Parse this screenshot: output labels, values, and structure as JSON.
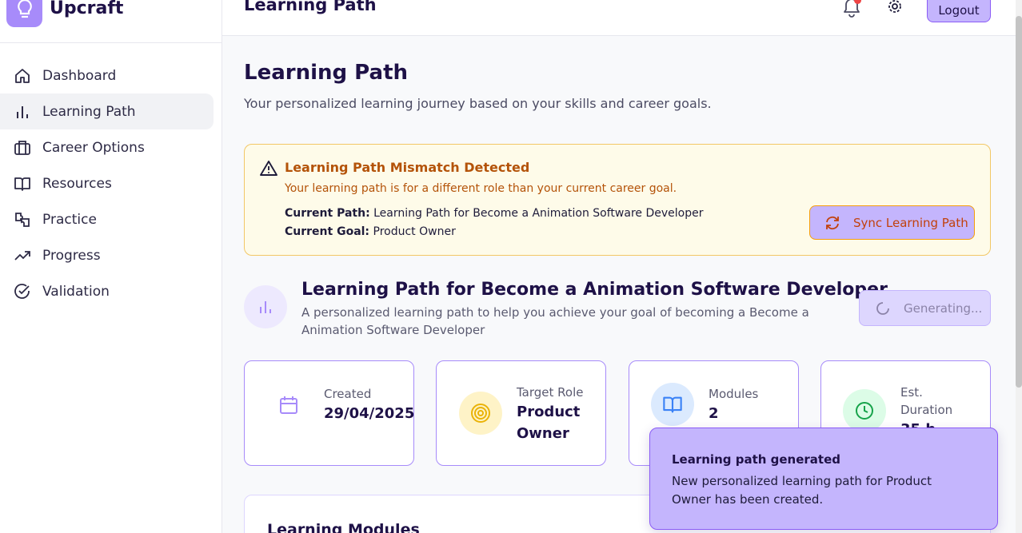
{
  "brand": {
    "name": "Upcraft",
    "accent": "#a78bfa"
  },
  "sidebar": {
    "items": [
      {
        "label": "Dashboard",
        "icon": "home-icon",
        "active": false
      },
      {
        "label": "Learning Path",
        "icon": "bar-chart-icon",
        "active": true
      },
      {
        "label": "Career Options",
        "icon": "briefcase-icon",
        "active": false
      },
      {
        "label": "Resources",
        "icon": "book-open-icon",
        "active": false
      },
      {
        "label": "Practice",
        "icon": "puzzle-icon",
        "active": false
      },
      {
        "label": "Progress",
        "icon": "trending-up-icon",
        "active": false
      },
      {
        "label": "Validation",
        "icon": "check-circle-icon",
        "active": false
      }
    ]
  },
  "header": {
    "title": "Learning Path",
    "logout_label": "Logout",
    "notification_icon": "bell-icon",
    "settings_icon": "gear-icon"
  },
  "page": {
    "title": "Learning Path",
    "subtitle": "Your personalized learning journey based on your skills and career goals."
  },
  "alert": {
    "title": "Learning Path Mismatch Detected",
    "description": "Your learning path is for a different role than your current career goal.",
    "current_path_label": "Current Path:",
    "current_path_value": "Learning Path for Become a Animation Software Developer",
    "current_goal_label": "Current Goal:",
    "current_goal_value": "Product Owner",
    "sync_label": "Sync Learning Path",
    "color": "#b45309"
  },
  "learning_path": {
    "title": "Learning Path for Become a Animation Software Developer",
    "description": "A personalized learning path to help you achieve your goal of becoming a Become a Animation Software Developer",
    "generating_label": "Generating..."
  },
  "stats": {
    "created": {
      "label": "Created",
      "value": "29/04/2025",
      "icon": "calendar-icon"
    },
    "target_role": {
      "label": "Target Role",
      "value_line1": "Product",
      "value_line2": "Owner",
      "icon": "target-icon"
    },
    "modules": {
      "label": "Modules",
      "value": "2",
      "icon": "book-open-icon"
    },
    "duration": {
      "label_line1": "Est.",
      "label_line2": "Duration",
      "value": "35 h",
      "icon": "clock-icon"
    }
  },
  "modules_section": {
    "title": "Learning Modules"
  },
  "toast": {
    "title": "Learning path generated",
    "description": "New personalized learning path for Product Owner has been created."
  }
}
